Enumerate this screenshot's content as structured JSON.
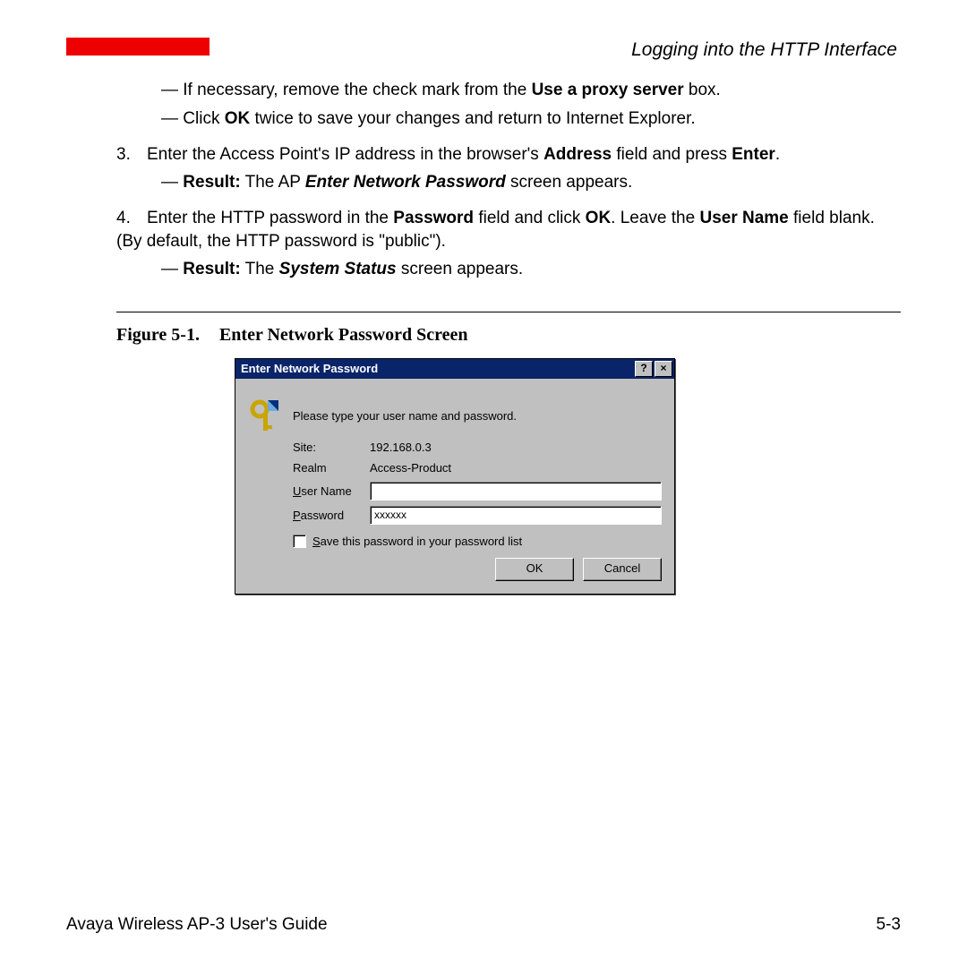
{
  "header": {
    "section_title": "Logging into the HTTP Interface"
  },
  "body": {
    "b1_pre": "— If necessary, remove the check mark from the ",
    "b1_bold": "Use a proxy server",
    "b1_post": " box.",
    "b2_pre": "— Click ",
    "b2_bold": "OK",
    "b2_post": " twice to save your changes and return to Internet Explorer.",
    "s3_num": "3.",
    "s3_pre": "Enter the Access Point's IP address in the browser's ",
    "s3_bold": "Address",
    "s3_mid": " field and press ",
    "s3_bold2": "Enter",
    "s3_post": ".",
    "s3_res_pre": "— ",
    "s3_res_bold": "Result:",
    "s3_res_mid": " The AP ",
    "s3_res_em": "Enter Network Password",
    "s3_res_post": " screen appears.",
    "s4_num": "4.",
    "s4_pre": "Enter the HTTP password in the ",
    "s4_bold1": "Password",
    "s4_mid1": " field and click ",
    "s4_bold2": "OK",
    "s4_mid2": ". Leave the ",
    "s4_bold3": "User Name",
    "s4_post": " field blank. (By default, the HTTP password is \"public\").",
    "s4_res_pre": "— ",
    "s4_res_bold": "Result:",
    "s4_res_mid": " The ",
    "s4_res_em": "System Status",
    "s4_res_post": " screen appears."
  },
  "figure": {
    "label": "Figure 5-1.",
    "title": "Enter Network Password Screen"
  },
  "dialog": {
    "title": "Enter Network Password",
    "help": "?",
    "close": "×",
    "instruction": "Please type your user name and password.",
    "site_label": "Site:",
    "site_value": "192.168.0.3",
    "realm_label": "Realm",
    "realm_value": "Access-Product",
    "user_label_u": "U",
    "user_label_rest": "ser Name",
    "pass_label_u": "P",
    "pass_label_rest": "assword",
    "password_value": "xxxxxx",
    "save_u": "S",
    "save_rest": "ave this password in your password list",
    "ok": "OK",
    "cancel": "Cancel"
  },
  "footer": {
    "guide": "Avaya Wireless AP-3 User's Guide",
    "page": "5-3"
  }
}
